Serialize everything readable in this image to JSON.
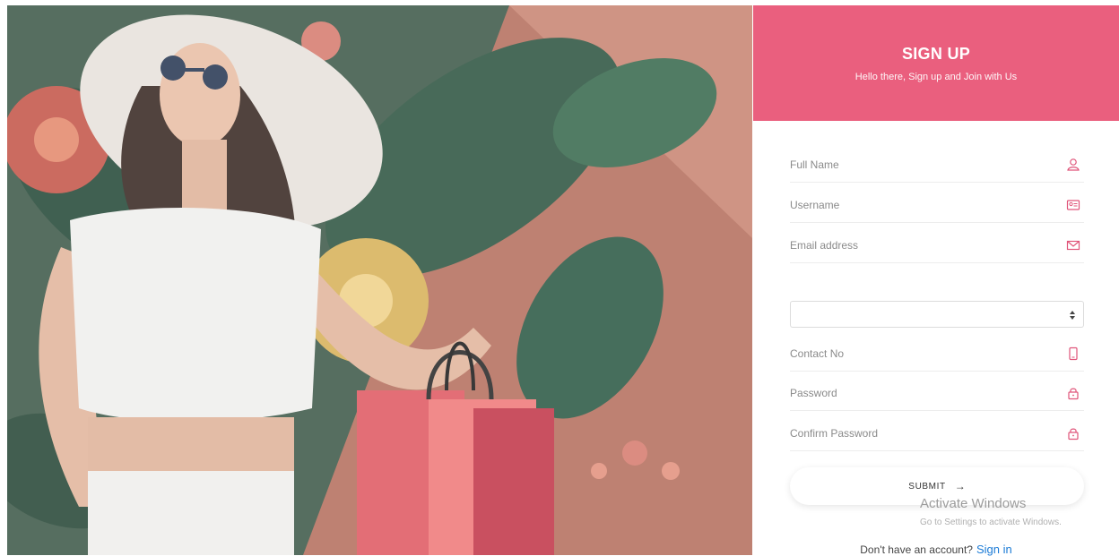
{
  "header": {
    "title": "SIGN UP",
    "subtitle": "Hello there, Sign up and Join with Us"
  },
  "form": {
    "full_name": {
      "placeholder": "Full Name",
      "icon": "user-icon"
    },
    "username": {
      "placeholder": "Username",
      "icon": "id-card-icon"
    },
    "email": {
      "placeholder": "Email address",
      "icon": "envelope-icon"
    },
    "select": {
      "value": "",
      "icon": "updown-arrows-icon"
    },
    "contact": {
      "placeholder": "Contact No",
      "icon": "phone-icon"
    },
    "password": {
      "placeholder": "Password",
      "icon": "lock-icon"
    },
    "confirm_password": {
      "placeholder": "Confirm Password",
      "icon": "lock-icon"
    },
    "submit_label": "SUBMIT",
    "submit_arrow": "→"
  },
  "footer": {
    "prompt": "Don't have an account?",
    "signin_link": "Sign in"
  },
  "watermark": {
    "line1": "Activate Windows",
    "line2": "Go to Settings to activate Windows."
  },
  "colors": {
    "accent": "#ea5f7e",
    "link": "#1c7bd6",
    "icon": "#e0557a"
  }
}
